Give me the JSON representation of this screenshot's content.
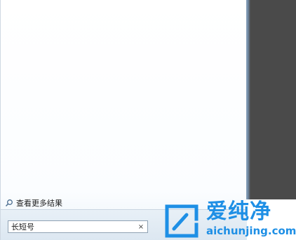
{
  "start_menu": {
    "see_more_results": "查看更多结果",
    "see_more_icon": "search-icon"
  },
  "search": {
    "value": "长短号",
    "clear_glyph": "×",
    "clear_icon": "close-icon"
  },
  "watermark": {
    "brand": "爱纯净",
    "domain": "aichunjing.com",
    "color": "#1e8fe5"
  }
}
